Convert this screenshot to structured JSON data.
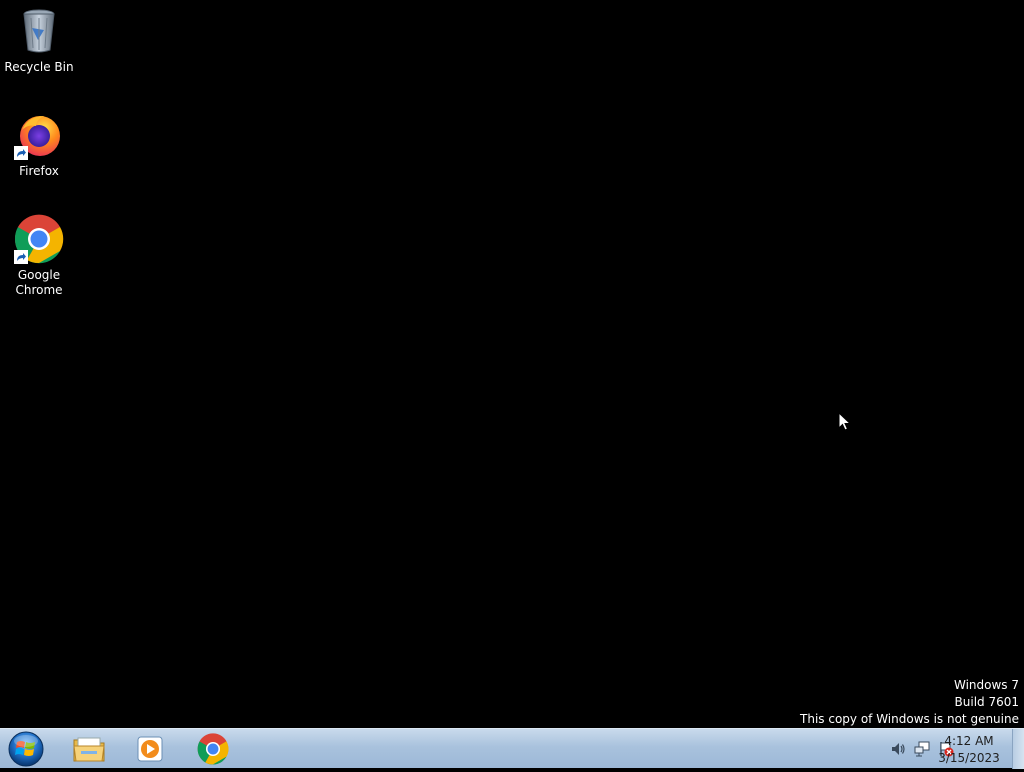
{
  "desktop": {
    "icons": [
      {
        "label": "Recycle Bin",
        "icon": "recycle-bin-icon"
      },
      {
        "label": "Firefox",
        "icon": "firefox-icon"
      },
      {
        "label": "Google\nChrome",
        "icon": "chrome-icon"
      }
    ],
    "watermark": {
      "line1": "Windows 7",
      "line2": "Build 7601",
      "line3": "This copy of Windows is not genuine"
    },
    "background_color": "#000000"
  },
  "taskbar": {
    "start_icon": "windows-start-orb-icon",
    "pinned": [
      {
        "icon": "file-explorer-icon",
        "name": "Windows Explorer"
      },
      {
        "icon": "media-player-icon",
        "name": "Windows Media Player"
      },
      {
        "icon": "chrome-icon",
        "name": "Google Chrome"
      }
    ],
    "tray": {
      "icons": [
        "volume-icon",
        "network-icon",
        "action-center-flag-icon"
      ],
      "time": "4:12 AM",
      "date": "3/15/2023"
    }
  }
}
